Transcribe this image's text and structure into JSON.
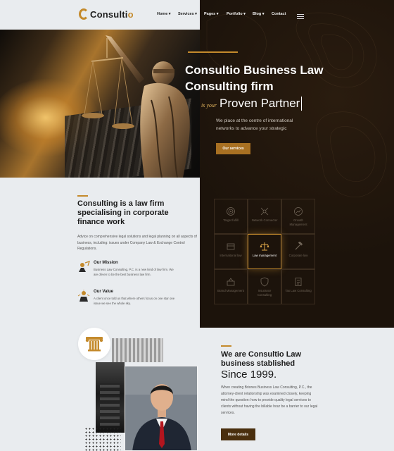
{
  "brand": {
    "name_main": "Consulti",
    "name_accent": "o"
  },
  "nav": [
    {
      "label": "Home ▾"
    },
    {
      "label": "Services ▾"
    },
    {
      "label": "Pages ▾"
    },
    {
      "label": "Portfolio ▾"
    },
    {
      "label": "Blog ▾"
    },
    {
      "label": "Contact"
    }
  ],
  "hero": {
    "title": "Consultio Business Law Consulting firm",
    "sub_small": "is your",
    "sub_big": "Proven Partner",
    "description": "We place at the centre of international networks to advance your strategic",
    "button": "Our services"
  },
  "about": {
    "title": "Consulting is a law firm specialising in corporate finance work",
    "description": "Advice on comprehensive legal solutions and legal planning on all aspects of business, including: issues under Company Law & Exchange Control Regulations.",
    "features": [
      {
        "title": "Our Mission",
        "desc": "Business Law Consulting, P.C. is a new kind of law firm. We are driven to be the best business law firm."
      },
      {
        "title": "Our Value",
        "desc": "A client once told us that where others focus on one star one issue we see the whole sky."
      }
    ]
  },
  "services": [
    {
      "label": "Target fulfill",
      "icon": "target-icon"
    },
    {
      "label": "Network Connecter",
      "icon": "network-icon"
    },
    {
      "label": "Growth Management",
      "icon": "growth-icon"
    },
    {
      "label": "Internaitonal law",
      "icon": "globe-icon"
    },
    {
      "label": "Law management",
      "icon": "scales-icon",
      "active": true
    },
    {
      "label": "Corporate law",
      "icon": "gavel-icon"
    },
    {
      "label": "Brand Management",
      "icon": "brand-icon"
    },
    {
      "label": "Insurance Consulting",
      "icon": "insurance-icon"
    },
    {
      "label": "Tax Law Consulting",
      "icon": "tax-icon"
    }
  ],
  "established": {
    "title": "We are Consultio Law business stablished",
    "since": "Since 1999.",
    "description": "When creating Briones Business Law Consulting, P.C., the attorney-client relationship was examined closely, keeping mind the question: how to provide quality legal services to clients without having the billable hour be a barrier to our legal services.",
    "button": "More details"
  },
  "colors": {
    "gold": "#c48a2c",
    "dark": "#1c130b",
    "light_bg": "#e9ecef"
  }
}
